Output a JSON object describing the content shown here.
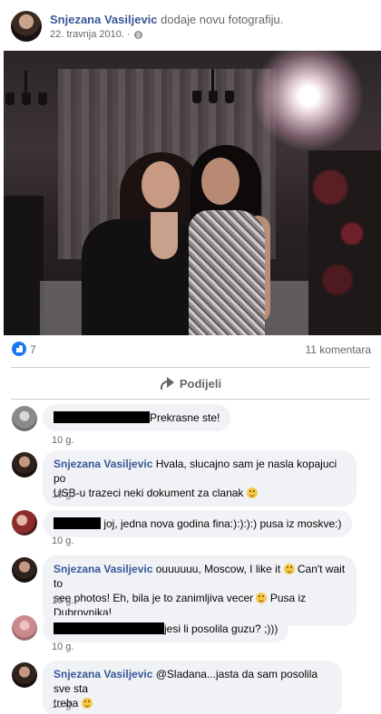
{
  "post": {
    "author": "Snjezana Vasiljevic",
    "action": "dodaje novu fotografiju.",
    "date": "22. travnja 2010. ·",
    "audience_icon": "globe-icon"
  },
  "reactions": {
    "like_icon": "like-icon",
    "count": "7",
    "comments": "11 komentara"
  },
  "actions": {
    "share_label": "Podijeli"
  },
  "comments": [
    {
      "author": "",
      "text": "Prekrasne ste!",
      "time": "10 g.",
      "redacted": true
    },
    {
      "author": "Snjezana Vasiljevic",
      "text_1": "Hvala, slucajno sam je nasla kopajuci po",
      "text_2": "USB-u trazeci neki dokument za clanak",
      "time": "10 g."
    },
    {
      "author": "",
      "text": "joj, jedna nova godina fina:):):):) pusa iz moskve:)",
      "time": "10 g.",
      "redacted": true
    },
    {
      "author": "Snjezana Vasiljevic",
      "text_1": "ouuuuuu, Moscow, I like it",
      "text_1b": "Can't wait to",
      "text_2": "see photos! Eh, bila je to zanimljiva vecer",
      "text_2b": "Pusa iz Dubrovnika!",
      "time": "10 g."
    },
    {
      "author": "",
      "text": "jesi li posolila guzu? ;)))",
      "time": "10 g.",
      "redacted": true
    },
    {
      "author": "Snjezana Vasiljevic",
      "text_1": "@Sladana...jasta da sam posolila sve sta",
      "text_2": "treba",
      "time": "10 g."
    }
  ]
}
